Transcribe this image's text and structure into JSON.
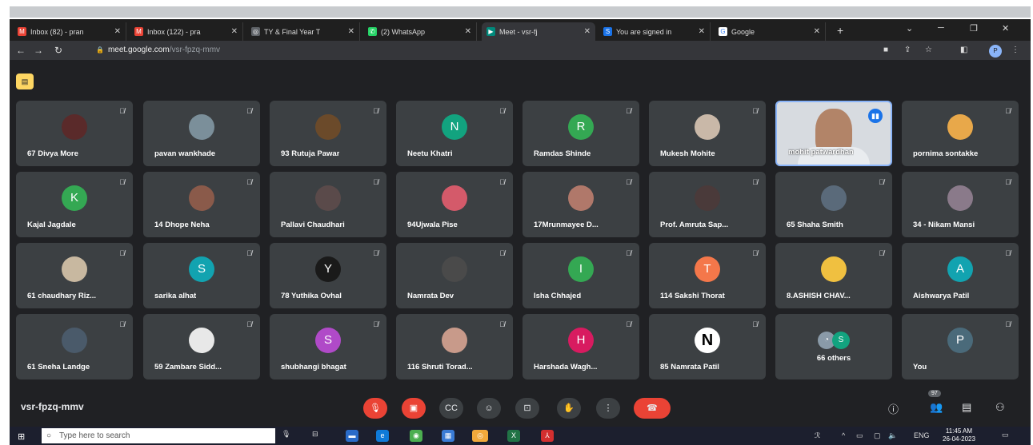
{
  "browser": {
    "tabs": [
      {
        "title": "Inbox (82) - pran",
        "icon": "gmail-icon",
        "color": "#ea4335",
        "glyph": "M"
      },
      {
        "title": "Inbox (122) - pra",
        "icon": "gmail-icon",
        "color": "#ea4335",
        "glyph": "M"
      },
      {
        "title": "TY & Final Year T",
        "icon": "globe-icon",
        "color": "#5f6368",
        "glyph": "◎"
      },
      {
        "title": "(2) WhatsApp",
        "icon": "whatsapp-icon",
        "color": "#25d366",
        "glyph": "✆"
      },
      {
        "title": "Meet - vsr-fj",
        "icon": "meet-icon",
        "color": "#00897b",
        "glyph": "▶"
      },
      {
        "title": "You are signed in",
        "icon": "s-icon",
        "color": "#1a73e8",
        "glyph": "S"
      },
      {
        "title": "Google",
        "icon": "google-icon",
        "color": "#ffffff",
        "glyph": "G"
      }
    ],
    "url_host": "meet.google.com",
    "url_path": "/vsr-fpzq-mmv",
    "profile_initial": "P",
    "new_tab": "+"
  },
  "participants": [
    {
      "name": "67 Divya More",
      "avatar": "photo",
      "color": "#5a2a2a",
      "initial": ""
    },
    {
      "name": "pavan wankhade",
      "avatar": "photo",
      "color": "#7b8f9a",
      "initial": ""
    },
    {
      "name": "93 Rutuja Pawar",
      "avatar": "photo",
      "color": "#6b4a2a",
      "initial": ""
    },
    {
      "name": "Neetu Khatri",
      "avatar": "letter",
      "color": "#12a37f",
      "initial": "N"
    },
    {
      "name": "Ramdas Shinde",
      "avatar": "letter",
      "color": "#34a853",
      "initial": "R"
    },
    {
      "name": "Mukesh Mohite",
      "avatar": "photo",
      "color": "#c9b8a8",
      "initial": ""
    },
    {
      "name": "mohit patwardhan",
      "avatar": "video",
      "color": "#d7dbe0",
      "initial": ""
    },
    {
      "name": "pornima sontakke",
      "avatar": "photo",
      "color": "#e8a84a",
      "initial": ""
    },
    {
      "name": "Kajal Jagdale",
      "avatar": "letter",
      "color": "#34a853",
      "initial": "K"
    },
    {
      "name": "14 Dhope Neha",
      "avatar": "photo",
      "color": "#8a5a4a",
      "initial": ""
    },
    {
      "name": "Pallavi Chaudhari",
      "avatar": "photo",
      "color": "#5a4a4a",
      "initial": ""
    },
    {
      "name": "94Ujwala Pise",
      "avatar": "photo",
      "color": "#d45a6a",
      "initial": ""
    },
    {
      "name": "17Mrunmayee D...",
      "avatar": "photo",
      "color": "#b0786a",
      "initial": ""
    },
    {
      "name": "Prof. Amruta Sap...",
      "avatar": "photo",
      "color": "#4a3a3a",
      "initial": ""
    },
    {
      "name": "65 Shaha Smith",
      "avatar": "photo",
      "color": "#5a6a7a",
      "initial": ""
    },
    {
      "name": "34 - Nikam Mansi",
      "avatar": "photo",
      "color": "#8a7a8a",
      "initial": ""
    },
    {
      "name": "61 chaudhary Riz...",
      "avatar": "photo",
      "color": "#c8b8a0",
      "initial": ""
    },
    {
      "name": "sarika alhat",
      "avatar": "letter",
      "color": "#12a3b0",
      "initial": "S"
    },
    {
      "name": "78 Yuthika Ovhal",
      "avatar": "letter",
      "color": "#1a1a1a",
      "initial": "Y"
    },
    {
      "name": "Namrata Dev",
      "avatar": "photo",
      "color": "#4a4a4a",
      "initial": ""
    },
    {
      "name": "Isha Chhajed",
      "avatar": "letter",
      "color": "#34a853",
      "initial": "I"
    },
    {
      "name": "114 Sakshi Thorat",
      "avatar": "letter",
      "color": "#f4774a",
      "initial": "T"
    },
    {
      "name": "8.ASHISH CHAV...",
      "avatar": "photo",
      "color": "#f0c040",
      "initial": ""
    },
    {
      "name": "Aishwarya Patil",
      "avatar": "letter",
      "color": "#12a3b0",
      "initial": "A"
    },
    {
      "name": "61 Sneha Landge",
      "avatar": "photo",
      "color": "#4a5a6a",
      "initial": ""
    },
    {
      "name": "59 Zambare Sidd...",
      "avatar": "photo",
      "color": "#e8e8e8",
      "initial": ""
    },
    {
      "name": "shubhangi bhagat",
      "avatar": "letter",
      "color": "#b04ac8",
      "initial": "S"
    },
    {
      "name": "116 Shruti Torad...",
      "avatar": "photo",
      "color": "#c89a8a",
      "initial": ""
    },
    {
      "name": "Harshada Wagh...",
      "avatar": "letter",
      "color": "#d81b60",
      "initial": "H"
    },
    {
      "name": "85 Namrata Patil",
      "avatar": "letter",
      "color": "#ffffff",
      "initial": "N"
    },
    {
      "name": "66 others",
      "avatar": "others",
      "color": "#3c4043",
      "initial": "S"
    },
    {
      "name": "You",
      "avatar": "letter",
      "color": "#4a6a7a",
      "initial": "P"
    }
  ],
  "meeting": {
    "code": "vsr-fpzq-mmv",
    "participant_count": "97"
  },
  "taskbar": {
    "search_placeholder": "Type here to search",
    "language": "ENG",
    "time": "11:45 AM",
    "date": "26-04-2023"
  }
}
